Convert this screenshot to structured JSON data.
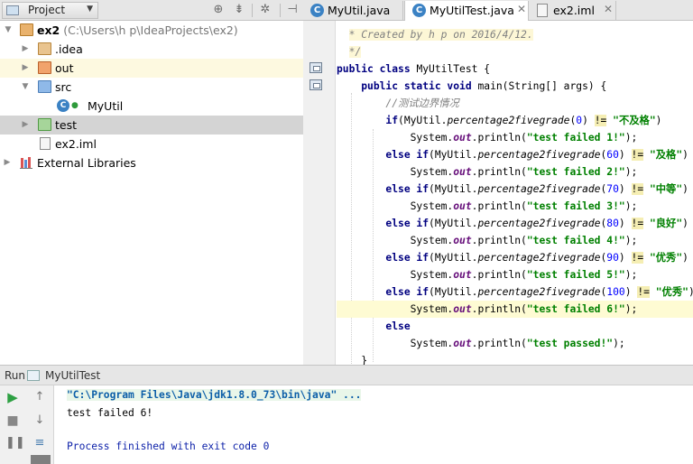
{
  "project_panel": {
    "view_label": "Project",
    "tree": [
      {
        "name": "ex2",
        "path": "(C:\\Users\\h p\\IdeaProjects\\ex2)"
      },
      {
        "name": ".idea"
      },
      {
        "name": "out"
      },
      {
        "name": "src"
      },
      {
        "name": "MyUtil"
      },
      {
        "name": "test"
      },
      {
        "name": "ex2.iml"
      },
      {
        "name": "External Libraries"
      }
    ]
  },
  "tabs": [
    {
      "label": "MyUtil.java"
    },
    {
      "label": "MyUtilTest.java"
    },
    {
      "label": "ex2.iml"
    }
  ],
  "code": {
    "comment_created": "* Created by h p on 2016/4/12.",
    "comment_end": "*/",
    "class_decl": "MyUtilTest {",
    "main_sig": "main(String[] args) {",
    "test_comment": "//测试边界情况",
    "cases": [
      {
        "arg": "0",
        "grade": "\"不及格\"",
        "msg": "\"test failed 1!\""
      },
      {
        "arg": "60",
        "grade": "\"及格\"",
        "msg": "\"test failed 2!\""
      },
      {
        "arg": "70",
        "grade": "\"中等\"",
        "msg": "\"test failed 3!\""
      },
      {
        "arg": "80",
        "grade": "\"良好\"",
        "msg": "\"test failed 4!\""
      },
      {
        "arg": "90",
        "grade": "\"优秀\"",
        "msg": "\"test failed 5!\""
      },
      {
        "arg": "100",
        "grade": "\"优秀\"",
        "msg": "\"test failed 6!\""
      }
    ],
    "passed_msg": "\"test passed!\"",
    "closing_brace": "}"
  },
  "run_panel": {
    "run_label": "Run",
    "config_name": "MyUtilTest",
    "console": {
      "command": "\"C:\\Program Files\\Java\\jdk1.8.0_73\\bin\\java\" ...",
      "output": "test failed 6!",
      "finished": "Process finished with exit code 0"
    }
  },
  "colors": {
    "keyword": "#000080",
    "string": "#008000",
    "comment": "#808080",
    "number": "#0000ff",
    "static_field": "#660e7a"
  }
}
